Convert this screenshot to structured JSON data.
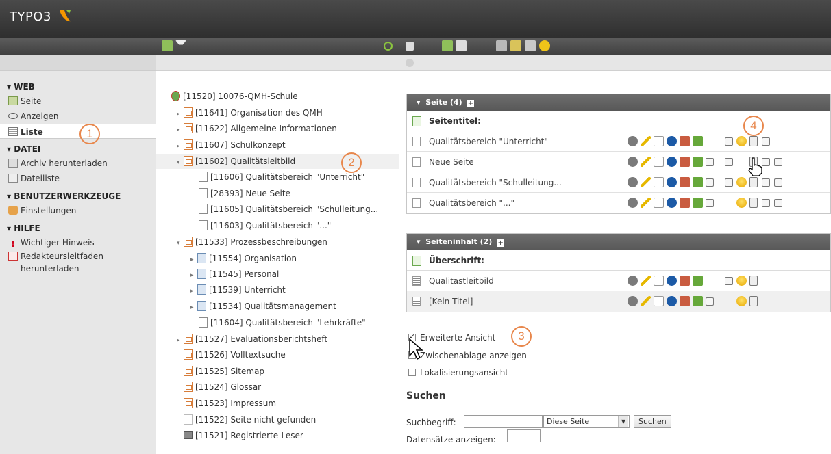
{
  "app": {
    "logo_text": "TYPO3"
  },
  "leftnav": {
    "groups": [
      {
        "title": "▾ WEB",
        "items": [
          {
            "label": "Seite",
            "icon": "page-module-icon"
          },
          {
            "label": "Anzeigen",
            "icon": "eye-icon"
          },
          {
            "label": "Liste",
            "icon": "list-icon",
            "active": true
          }
        ]
      },
      {
        "title": "▾ DATEI",
        "items": [
          {
            "label": "Archiv herunterladen",
            "icon": "archive-icon"
          },
          {
            "label": "Dateiliste",
            "icon": "folder-icon"
          }
        ]
      },
      {
        "title": "▾ BENUTZERWERKZEUGE",
        "items": [
          {
            "label": "Einstellungen",
            "icon": "user-settings-icon"
          }
        ]
      },
      {
        "title": "▾ HILFE",
        "items": [
          {
            "label": "Wichtiger Hinweis",
            "icon": "exclamation-icon"
          },
          {
            "label": "Redakteursleitfaden",
            "icon": "pdf-icon"
          },
          {
            "label": "herunterladen",
            "icon": ""
          }
        ]
      }
    ]
  },
  "tree": {
    "root": "[11520] 10076-QMH-Schule",
    "rows": [
      "[11641] Organisation des QMH",
      "[11622] Allgemeine Informationen",
      "[11607] Schulkonzept",
      "[11602] Qualitätsleitbild",
      "[11606] Qualitätsbereich \"Unterricht\"",
      "[28393] Neue Seite",
      "[11605] Qualitätsbereich \"Schulleitung...",
      "[11603] Qualitätsbereich \"...\"",
      "[11533] Prozessbeschreibungen",
      "[11554] Organisation",
      "[11545] Personal",
      "[11539] Unterricht",
      "[11534] Qualitätsmanagement",
      "[11604] Qualitätsbereich \"Lehrkräfte\"",
      "[11527] Evaluationsberichtsheft",
      "[11526] Volltextsuche",
      "[11525] Sitemap",
      "[11524] Glossar",
      "[11523] Impressum",
      "[11522] Seite nicht gefunden",
      "[11521] Registrierte-Leser"
    ]
  },
  "pages_panel": {
    "header": "Seite (4)",
    "column_title": "Seitentitel:",
    "rows": [
      "Qualitätsbereich \"Unterricht\"",
      "Neue Seite",
      "Qualitätsbereich \"Schulleitung...",
      "Qualitätsbereich \"...\""
    ]
  },
  "content_panel": {
    "header": "Seiteninhalt (2)",
    "column_title": "Überschrift:",
    "rows": [
      "Qualitastleitbild",
      "[Kein Titel]"
    ]
  },
  "options": {
    "extended_view": "Erweiterte Ansicht",
    "clipboard": "Zwischenablage anzeigen",
    "localization": "Lokalisierungsansicht"
  },
  "search": {
    "title": "Suchen",
    "term_label": "Suchbegriff:",
    "scope_value": "Diese Seite",
    "button": "Suchen",
    "records_label": "Datensätze anzeigen:"
  },
  "callouts": [
    "1",
    "2",
    "3",
    "4"
  ],
  "colors": {
    "accent": "#e8874c",
    "topbar": "#333333",
    "panel_head": "#616161"
  }
}
